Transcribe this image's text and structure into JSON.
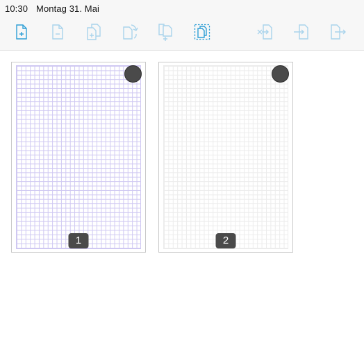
{
  "status": {
    "time": "10:30",
    "date": "Montag 31. Mai"
  },
  "toolbar": {
    "accent_color": "#2f9fd6",
    "muted_color": "#a9d4ec",
    "buttons": [
      {
        "name": "add-page-icon",
        "state": "active"
      },
      {
        "name": "delete-page-icon",
        "state": "disabled"
      },
      {
        "name": "duplicate-page-icon",
        "state": "disabled"
      },
      {
        "name": "rotate-page-icon",
        "state": "disabled"
      },
      {
        "name": "insert-pages-icon",
        "state": "disabled"
      },
      {
        "name": "select-all-pages-icon",
        "state": "active"
      },
      {
        "name": "move-page-out-icon",
        "state": "disabled"
      },
      {
        "name": "move-page-in-icon",
        "state": "disabled"
      },
      {
        "name": "export-page-icon",
        "state": "disabled"
      }
    ]
  },
  "pages": [
    {
      "number": "1",
      "paper": "blue grid"
    },
    {
      "number": "2",
      "paper": "grey grid"
    }
  ]
}
